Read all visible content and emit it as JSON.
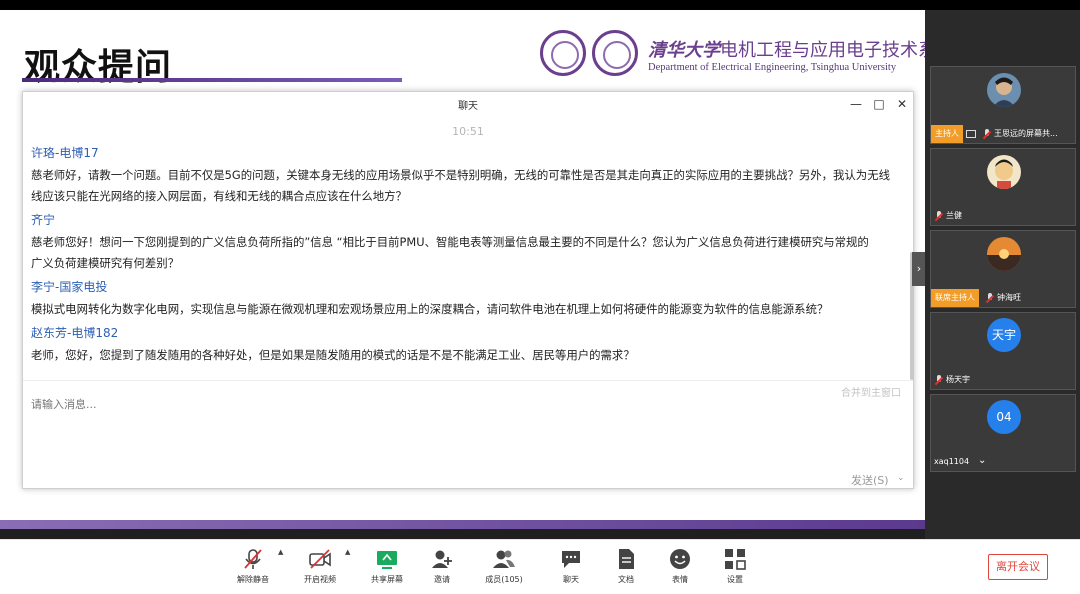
{
  "slide": {
    "title": "观众提问",
    "university_cn": "清华大学",
    "department_cn": "电机工程与应用电子技术系",
    "department_en": "Department of Electrical Engineering, Tsinghua University"
  },
  "chat": {
    "title": "聊天",
    "time": "10:51",
    "messages": [
      {
        "name": "许珞-电博17",
        "lines": [
          "慈老师好，请教一个问题。目前不仅是5G的问题，关键本身无线的应用场景似乎不是特别明确，无线的可靠性是否是其走向真正的实际应用的主要挑战？另外，我认为无线",
          "线应该只能在光网络的接入网层面，有线和无线的耦合点应该在什么地方？"
        ]
      },
      {
        "name": "齐宁",
        "lines": [
          "慈老师您好！想问一下您刚提到的广义信息负荷所指的”信息 “相比于目前PMU、智能电表等测量信息最主要的不同是什么？您认为广义信息负荷进行建模研究与常规的",
          "广义负荷建模研究有何差别？"
        ]
      },
      {
        "name": "李宁-国家电投",
        "lines": [
          "模拟式电网转化为数字化电网，实现信息与能源在微观机理和宏观场景应用上的深度耦合，请问软件电池在机理上如何将硬件的能源变为软件的信息能源系统？"
        ]
      },
      {
        "name": "赵东芳-电博182",
        "lines": [
          "老师，您好，您提到了随发随用的各种好处，但是如果是随发随用的模式的话是不是不能满足工业、居民等用户的需求？"
        ]
      }
    ],
    "merge_label": "合并到主窗口",
    "input_placeholder": "请输入消息...",
    "send_label": "发送(S)"
  },
  "participants": [
    {
      "role": "主持人",
      "name": "王思远的屏幕共...",
      "type": "photo"
    },
    {
      "role": "",
      "name": "兰健",
      "type": "photo"
    },
    {
      "role": "联席主持人",
      "name": "钟海旺",
      "type": "photo"
    },
    {
      "role": "",
      "name": "杨天宇",
      "type": "text",
      "avatar_text": "天宇"
    },
    {
      "role": "",
      "name": "xaq1104",
      "type": "text",
      "avatar_text": "04"
    }
  ],
  "toolbar": {
    "unmute": "解除静音",
    "start_video": "开启视频",
    "share_screen": "共享屏幕",
    "invite": "邀请",
    "members": "成员(105)",
    "chat": "聊天",
    "docs": "文档",
    "reactions": "表情",
    "settings": "设置",
    "leave": "离开会议"
  },
  "colors": {
    "accent_purple": "#6b3f8e",
    "name_blue": "#2d5fb4",
    "host_badge": "#f29d2a",
    "leave_red": "#e0453a",
    "avatar_blue": "#2680eb"
  }
}
